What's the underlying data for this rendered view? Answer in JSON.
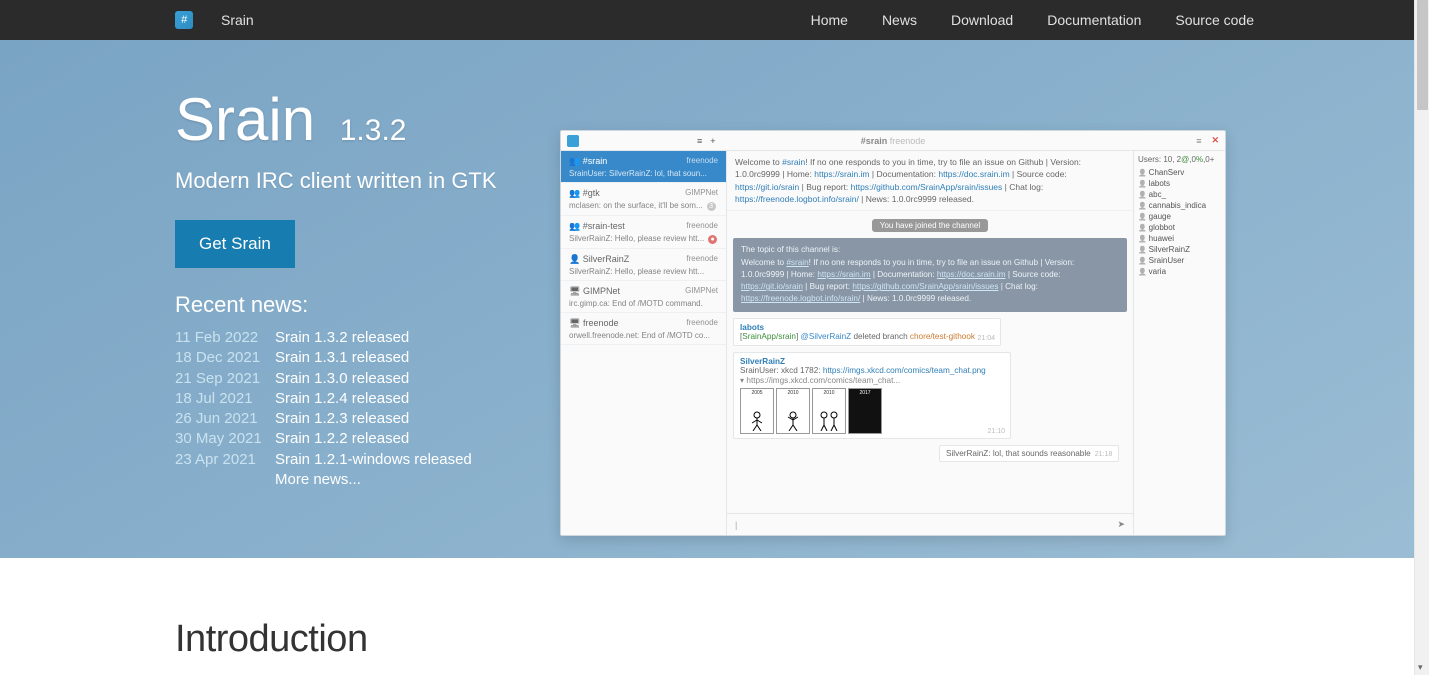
{
  "nav": {
    "brand": "Srain",
    "logo_glyph": "#",
    "links": [
      "Home",
      "News",
      "Download",
      "Documentation",
      "Source code"
    ]
  },
  "hero": {
    "title": "Srain",
    "version": "1.3.2",
    "tagline": "Modern IRC client written in GTK",
    "cta": "Get Srain",
    "news_heading": "Recent news:",
    "news": [
      {
        "date": "11 Feb 2022",
        "title": "Srain 1.3.2 released"
      },
      {
        "date": "18 Dec 2021",
        "title": "Srain 1.3.1 released"
      },
      {
        "date": "21 Sep 2021",
        "title": "Srain 1.3.0 released"
      },
      {
        "date": "18 Jul 2021",
        "title": "Srain 1.2.4 released"
      },
      {
        "date": "26 Jun 2021",
        "title": "Srain 1.2.3 released"
      },
      {
        "date": "30 May 2021",
        "title": "Srain 1.2.2 released"
      },
      {
        "date": "23 Apr 2021",
        "title": "Srain 1.2.1-windows released"
      }
    ],
    "more_news": "More news..."
  },
  "intro": {
    "heading": "Introduction"
  },
  "screenshot": {
    "header": {
      "hamburger": "≡",
      "plus": "+",
      "channel": "#srain",
      "network": "freenode",
      "menu": "≡",
      "close": "✕"
    },
    "side_channels": [
      {
        "icon": "👥",
        "name": "#srain",
        "net": "freenode",
        "preview": "SrainUser: SilverRainZ:  lol, that soun...",
        "active": true
      },
      {
        "icon": "👥",
        "name": "#gtk",
        "net": "GIMPNet",
        "preview": "mclasen: on the surface, it'll be som...",
        "badge": "3"
      },
      {
        "icon": "👥",
        "name": "#srain-test",
        "net": "freenode",
        "preview": "SilverRainZ: Hello, please review htt...",
        "badge_red": "●"
      },
      {
        "icon": "👤",
        "name": "SilverRainZ",
        "net": "freenode",
        "preview": "SilverRainZ: Hello, please review htt..."
      },
      {
        "icon": "🖥",
        "name": "GIMPNet",
        "net": "GIMPNet",
        "preview": "irc.gimp.ca: End of /MOTD command."
      },
      {
        "icon": "🖥",
        "name": "freenode",
        "net": "freenode",
        "preview": "orwell.freenode.net: End of /MOTD co..."
      }
    ],
    "topic": {
      "t1": "Welcome to ",
      "link1": "#srain",
      "t2": "! If no one responds to you in time, try to file an issue on Github | Version: 1.0.0rc9999 | Home: ",
      "home": "https://srain.im",
      "t3": " | Documentation: ",
      "doc": "https://doc.srain.im",
      "t4": " | Source code: ",
      "src": "https://git.io/srain",
      "t5": " | Bug report: ",
      "bug": "https://github.com/SrainApp/srain/issues",
      "t6": " | Chat log: ",
      "log": "https://freenode.logbot.info/srain/",
      "t7": " | News: 1.0.0rc9999 released."
    },
    "joined_pill": "You have joined the channel",
    "topic_box": {
      "l1": "The topic of this channel is:",
      "l2a": "    Welcome to ",
      "ch": "#srain",
      "l2b": "! If no one responds to you in time, try to file an issue on Github | Version: 1.0.0rc9999 | Home: ",
      "home": "https://srain.im",
      "l2c": " | Documentation: ",
      "doc": "https://doc.srain.im",
      "l2d": " | Source code: ",
      "src": "https://git.io/srain",
      "l2e": " | Bug report: ",
      "bug": "https://github.com/SrainApp/srain/issues",
      "l2f": " | Chat log: ",
      "log": "https://freenode.logbot.info/srain/",
      "l2g": " | News: 1.0.0rc9999 released."
    },
    "msg1": {
      "user": "labots",
      "pre": "[",
      "repo": "SrainApp/srain",
      "post": "] ",
      "at": "@SilverRainZ",
      "rest": " deleted branch ",
      "branch": "chore/test-githook",
      "ts": "21:04"
    },
    "msg2": {
      "user": "SilverRainZ",
      "line1_pre": "SrainUser: xkcd 1782: ",
      "link": "https://imgs.xkcd.com/comics/team_chat.png",
      "caret": "▾ ",
      "line2": "https://imgs.xkcd.com/comics/team_chat...",
      "panels": [
        "2005",
        "2010",
        "2010",
        "2017"
      ],
      "ts": "21:10"
    },
    "reply": {
      "text": "SilverRainZ:  lol, that sounds reasonable",
      "ts": "21:18"
    },
    "input": {
      "prompt": "|",
      "send": "➤"
    },
    "users": {
      "count_pre": "Users: 10, 2",
      "at": "@",
      "count_mid": ",0",
      "pct": "%",
      "count_post": ",0+",
      "list": [
        "ChanServ",
        "labots",
        "abc_",
        "cannabis_indica",
        "gauge",
        "globbot",
        "huawei",
        "SilverRainZ",
        "SrainUser",
        "varia"
      ]
    }
  }
}
